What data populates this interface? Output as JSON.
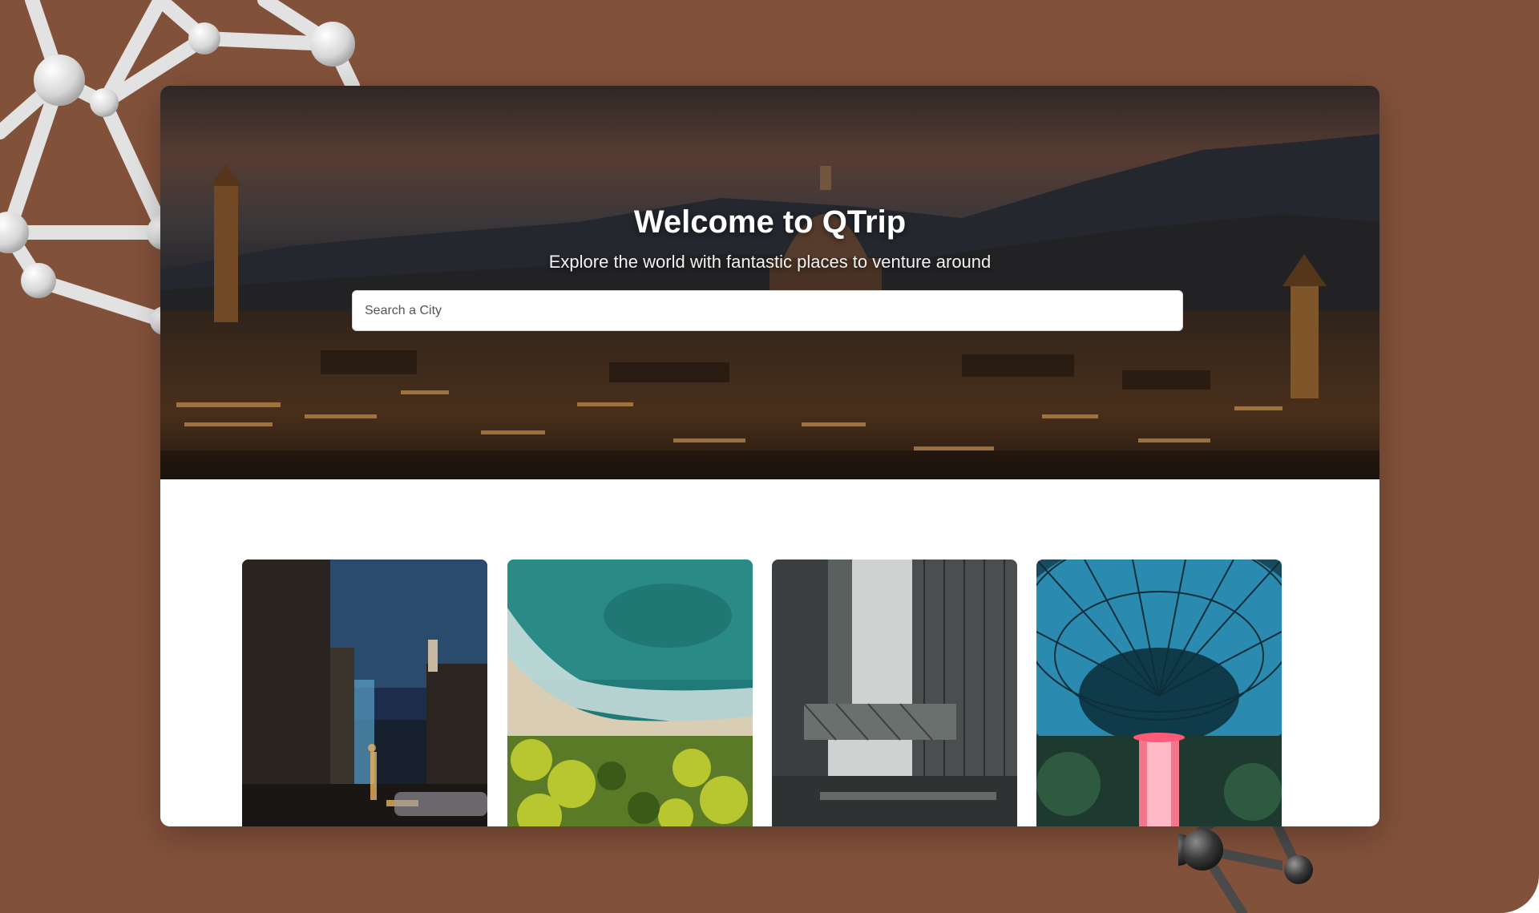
{
  "hero": {
    "title": "Welcome to QTrip",
    "subtitle": "Explore the world with fantastic places to venture around"
  },
  "search": {
    "placeholder": "Search a City",
    "value": ""
  },
  "cities": [
    {
      "image": "night-city-street"
    },
    {
      "image": "aerial-beach-coast"
    },
    {
      "image": "skyscrapers-skybridge"
    },
    {
      "image": "glass-dome-waterfall"
    }
  ],
  "colors": {
    "backdrop": "#82513a",
    "panel": "#ffffff",
    "hero_text": "#ffffff"
  },
  "decorations": {
    "left": "white-molecule-model",
    "right": "dark-molecule-model"
  }
}
